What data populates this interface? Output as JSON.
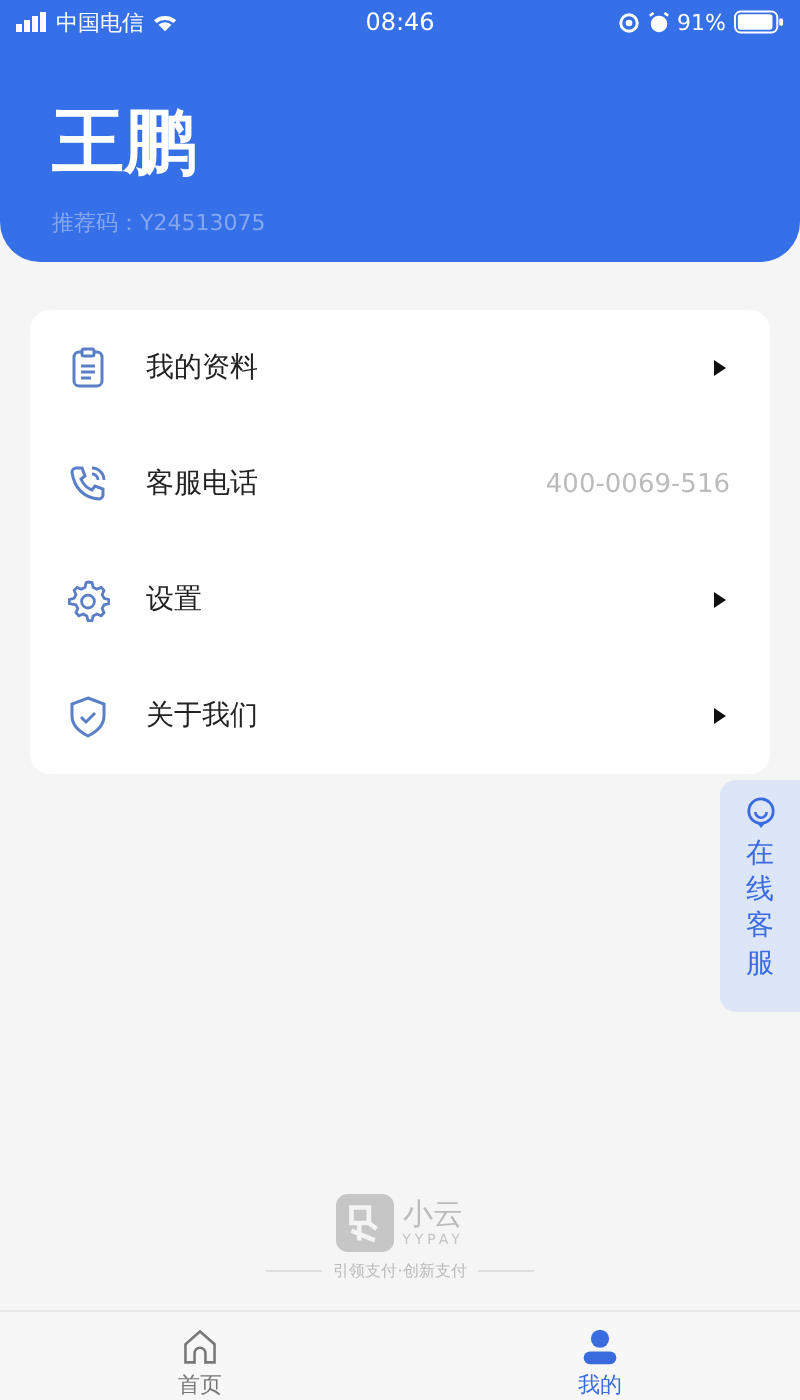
{
  "status_bar": {
    "carrier": "中国电信",
    "time": "08:46",
    "battery": "91%"
  },
  "profile": {
    "name": "王鹏",
    "referral": "推荐码：Y24513075"
  },
  "menu": [
    {
      "label": "我的资料",
      "kind": "arrow"
    },
    {
      "label": "客服电话",
      "kind": "value",
      "value": "400-0069-516"
    },
    {
      "label": "设置",
      "kind": "arrow"
    },
    {
      "label": "关于我们",
      "kind": "arrow"
    }
  ],
  "float_service": {
    "label": "在线客服"
  },
  "brand": {
    "name": "小云",
    "sub": "YYPAY",
    "slogan": "引领支付·创新支付"
  },
  "tabs": [
    {
      "label": "首页",
      "selected": false
    },
    {
      "label": "我的",
      "selected": true
    }
  ]
}
